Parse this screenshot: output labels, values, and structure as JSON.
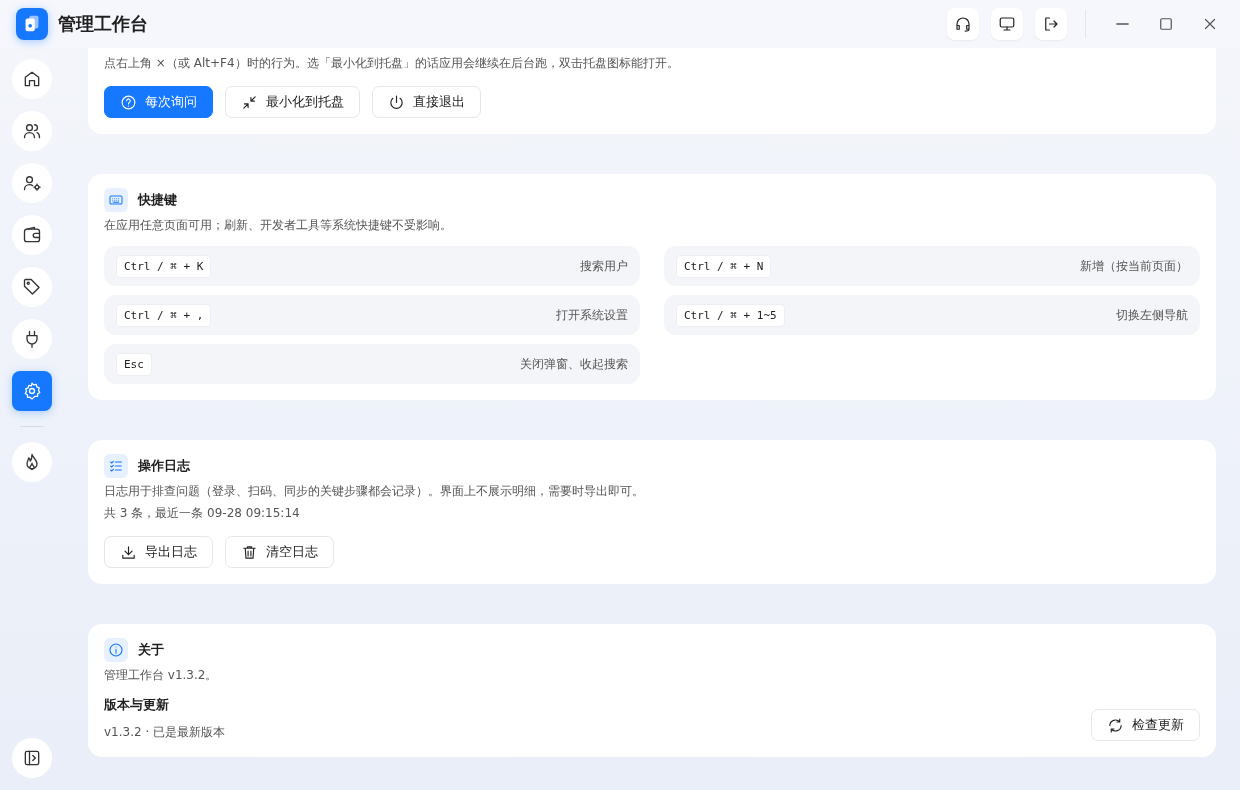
{
  "app": {
    "title": "管理工作台"
  },
  "toolbar": [
    {
      "kind": "headset"
    },
    {
      "kind": "monitor"
    },
    {
      "kind": "logout"
    }
  ],
  "window_controls": [
    {
      "kind": "minimize"
    },
    {
      "kind": "maximize"
    },
    {
      "kind": "close"
    }
  ],
  "sidebar": {
    "items": [
      {
        "kind": "home",
        "selected": false
      },
      {
        "kind": "users",
        "selected": false
      },
      {
        "kind": "user-gear",
        "selected": false
      },
      {
        "kind": "wallet",
        "selected": false
      },
      {
        "kind": "tag",
        "selected": false
      },
      {
        "kind": "plug",
        "selected": false
      },
      {
        "kind": "gear",
        "selected": true
      }
    ],
    "extra": [
      {
        "kind": "flame",
        "selected": false
      }
    ]
  },
  "close_behavior": {
    "description": "点右上角 ×（或 Alt+F4）时的行为。选「最小化到托盘」的话应用会继续在后台跑，双击托盘图标能打开。",
    "options": [
      {
        "kind": "ask",
        "label": "每次询问",
        "selected": true
      },
      {
        "kind": "minimize",
        "label": "最小化到托盘",
        "selected": false
      },
      {
        "kind": "quit",
        "label": "直接退出",
        "selected": false
      }
    ]
  },
  "shortcuts": {
    "title": "快捷键",
    "description": "在应用任意页面可用；刷新、开发者工具等系统快捷键不受影响。",
    "items": [
      {
        "keys": "Ctrl / ⌘ + K",
        "action": "搜索用户"
      },
      {
        "keys": "Ctrl / ⌘ + N",
        "action": "新增（按当前页面）"
      },
      {
        "keys": "Ctrl / ⌘ + ,",
        "action": "打开系统设置"
      },
      {
        "keys": "Ctrl / ⌘ + 1~5",
        "action": "切换左侧导航"
      },
      {
        "keys": "Esc",
        "action": "关闭弹窗、收起搜索"
      }
    ]
  },
  "logs": {
    "title": "操作日志",
    "description": "日志用于排查问题（登录、扫码、同步的关键步骤都会记录）。界面上不展示明细，需要时导出即可。",
    "summary": "共 3 条，最近一条 09-28 09:15:14",
    "buttons": [
      {
        "kind": "export",
        "label": "导出日志"
      },
      {
        "kind": "clear",
        "label": "清空日志"
      }
    ]
  },
  "about": {
    "title": "关于",
    "description": "管理工作台 v1.3.2。",
    "update_title": "版本与更新",
    "update_status": "v1.3.2 · 已是最新版本",
    "check_button": "检查更新"
  }
}
